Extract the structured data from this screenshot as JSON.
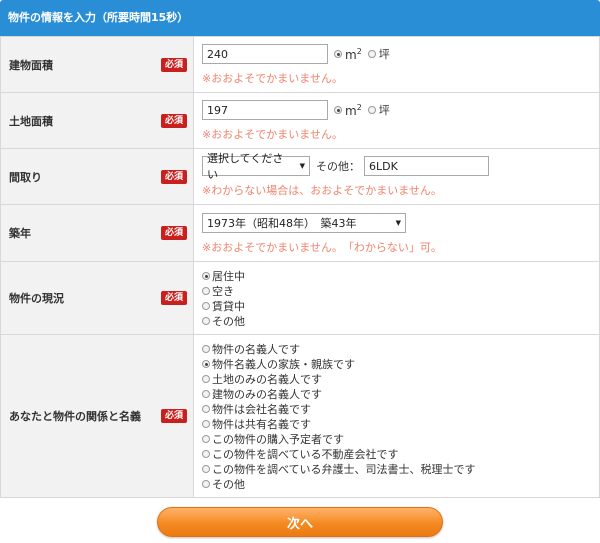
{
  "header": {
    "title": "物件の情報を入力（所要時間15秒）"
  },
  "required_label": "必須",
  "building_area": {
    "label": "建物面積",
    "value": "240",
    "unit_m": "m",
    "unit_m_sup": "2",
    "unit_tsubo": "坪",
    "selected": "m2",
    "note": "※おおよそでかまいません。"
  },
  "land_area": {
    "label": "土地面積",
    "value": "197",
    "unit_m": "m",
    "unit_m_sup": "2",
    "unit_tsubo": "坪",
    "selected": "m2",
    "note": "※おおよそでかまいません。"
  },
  "layout": {
    "label": "間取り",
    "select_value": "選択してください",
    "other_label": "その他：",
    "other_value": "6LDK",
    "note": "※わからない場合は、おおよそでかまいません。"
  },
  "age": {
    "label": "築年",
    "select_value": "1973年（昭和48年）　築43年",
    "note": "※おおよそでかまいません。　「わからない」可。"
  },
  "status": {
    "label": "物件の現況",
    "options": [
      "居住中",
      "空き",
      "賃貸中",
      "その他"
    ],
    "selected_index": 0
  },
  "relation": {
    "label": "あなたと物件の関係と名義",
    "options": [
      "物件の名義人です",
      "物件名義人の家族・親族です",
      "土地のみの名義人です",
      "建物のみの名義人です",
      "物件は会社名義です",
      "物件は共有名義です",
      "この物件の購入予定者です",
      "この物件を調べている不動産会社です",
      "この物件を調べている弁護士、司法書士、税理士です",
      "その他"
    ],
    "selected_index": 1
  },
  "next_button": {
    "label": "次へ"
  },
  "colors": {
    "header": "#2a8ed6",
    "required": "#c8201e",
    "note": "#f0846d",
    "button": "#f48a22"
  }
}
